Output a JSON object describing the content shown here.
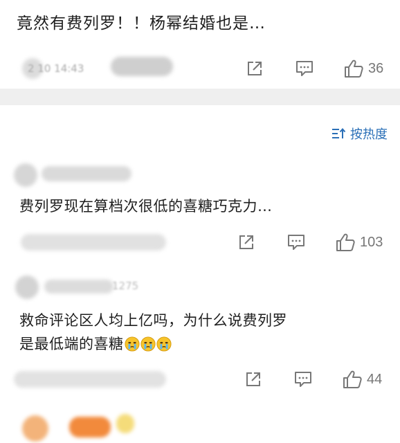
{
  "post": {
    "text": "竟然有费列罗！！杨幂结婚也是…",
    "meta_time": "2 10 14:43",
    "likes": "36",
    "share_icon": "share-icon",
    "comment_icon": "comment-icon",
    "like_icon": "thumbs-up-icon"
  },
  "sort": {
    "label": "按热度",
    "icon": "sort-icon",
    "color": "#2a6fb7"
  },
  "comments": [
    {
      "text_lines": [
        "费列罗现在算档次很低的喜糖巧克力…"
      ],
      "likes": "103"
    },
    {
      "author_fragment": "1275",
      "text_lines": [
        "救命评论区人均上亿吗，为什么说费列罗",
        "是最低端的喜糖"
      ],
      "emoji_icon": "crying-face-emoji-icon",
      "likes": "44"
    }
  ],
  "colors": {
    "divider": "#efefef",
    "icon_gray": "#777777",
    "text": "#1e1e1e"
  }
}
